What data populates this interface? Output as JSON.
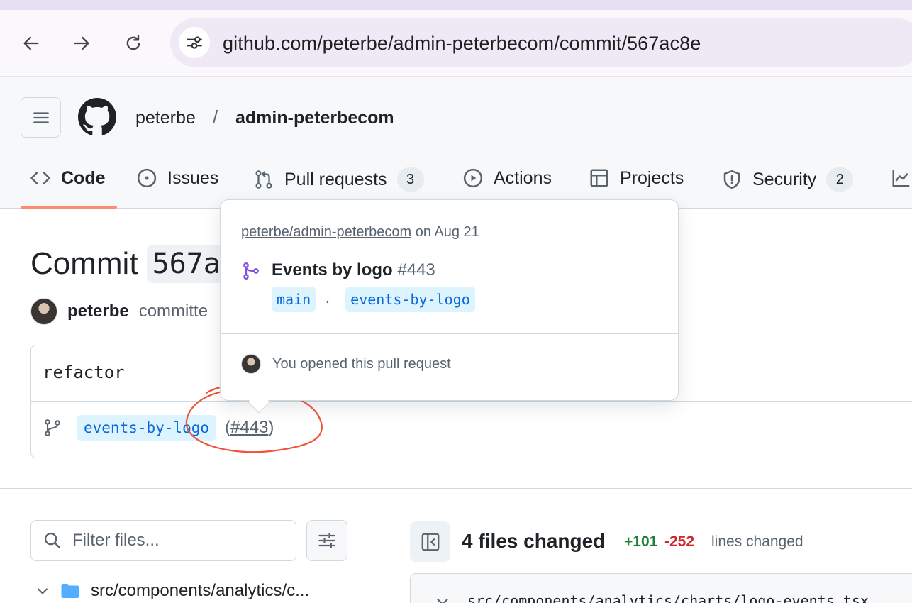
{
  "browser": {
    "url": "github.com/peterbe/admin-peterbecom/commit/567ac8e"
  },
  "header": {
    "owner": "peterbe",
    "separator": "/",
    "repo": "admin-peterbecom"
  },
  "tabs": [
    {
      "label": "Code",
      "icon": "code-icon",
      "selected": true
    },
    {
      "label": "Issues",
      "icon": "issue-opened-icon"
    },
    {
      "label": "Pull requests",
      "icon": "git-pull-request-icon",
      "count": "3"
    },
    {
      "label": "Actions",
      "icon": "play-icon"
    },
    {
      "label": "Projects",
      "icon": "table-icon"
    },
    {
      "label": "Security",
      "icon": "shield-icon",
      "count": "2"
    }
  ],
  "commit": {
    "title_prefix": "Commit",
    "sha": "567a",
    "author": "peterbe",
    "action": "committe",
    "message": "refactor",
    "branch": "events-by-logo",
    "pr_open": "(",
    "pr_number": "#443",
    "pr_close": ")"
  },
  "hovercard": {
    "repo": "peterbe/admin-peterbecom",
    "date": " on Aug 21",
    "pr_title": "Events by logo",
    "pr_number": "#443",
    "base_branch": "main",
    "arrow": "←",
    "head_branch": "events-by-logo",
    "footer": "You opened this pull request"
  },
  "files": {
    "filter_placeholder": "Filter files...",
    "tree_first_item": "src/components/analytics/c...",
    "summary": "4 files changed",
    "additions": "+101",
    "deletions": "-252",
    "lines_label": "lines changed",
    "first_file_path": "src/components/analytics/charts/logo-events.tsx"
  },
  "colors": {
    "accent_underline": "#fd8c73",
    "annotation": "#f0523a",
    "branch_chip_bg": "#ddf4ff",
    "branch_chip_fg": "#0969da",
    "additions": "#1a7f37",
    "deletions": "#d1242f",
    "pr_icon": "#8250df"
  }
}
